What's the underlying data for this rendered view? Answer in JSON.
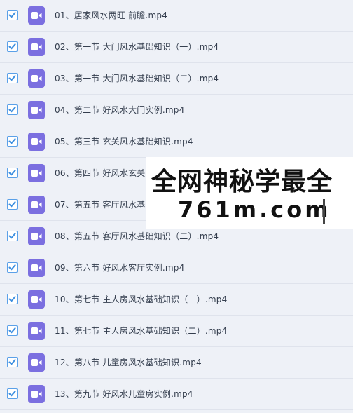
{
  "files": [
    {
      "name": "01、居家风水两旺 前瞻.mp4",
      "checked": true
    },
    {
      "name": "02、第一节 大门风水基础知识（一）.mp4",
      "checked": true
    },
    {
      "name": "03、第一节 大门风水基础知识（二）.mp4",
      "checked": true
    },
    {
      "name": "04、第二节 好风水大门实例.mp4",
      "checked": true
    },
    {
      "name": "05、第三节 玄关风水基础知识.mp4",
      "checked": true
    },
    {
      "name": "06、第四节 好风水玄关",
      "checked": true
    },
    {
      "name": "07、第五节 客厅风水基",
      "checked": true
    },
    {
      "name": "08、第五节 客厅风水基础知识（二）.mp4",
      "checked": true
    },
    {
      "name": "09、第六节 好风水客厅实例.mp4",
      "checked": true
    },
    {
      "name": "10、第七节 主人房风水基础知识（一）.mp4",
      "checked": true
    },
    {
      "name": "11、第七节 主人房风水基础知识（二）.mp4",
      "checked": true
    },
    {
      "name": "12、第八节 儿童房风水基础知识.mp4",
      "checked": true
    },
    {
      "name": "13、第九节 好风水儿童房实例.mp4",
      "checked": true
    }
  ],
  "icons": {
    "checkbox": "checkmark-icon",
    "file": "video-file-icon"
  },
  "colors": {
    "check": "#3d8fe0",
    "file_icon": "#7b6fe0",
    "row_background": "#eef1f7"
  },
  "watermark": {
    "title": "全网神秘学最全",
    "subtitle": "761m.com"
  }
}
